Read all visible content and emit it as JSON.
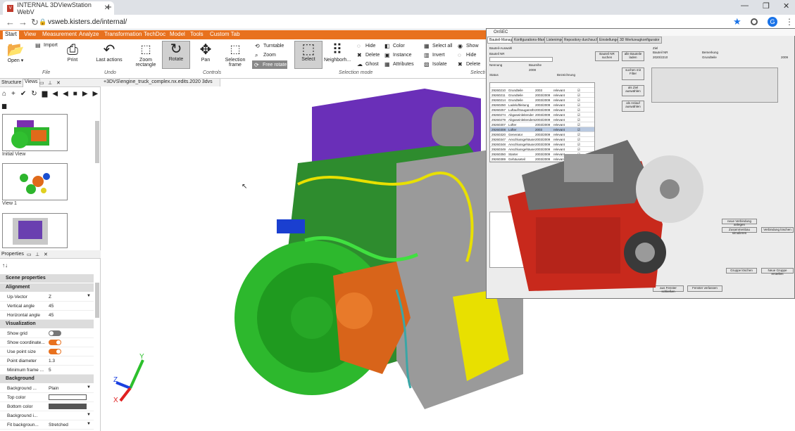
{
  "browser": {
    "tab_title": "INTERNAL 3DViewStation WebV",
    "url": "vsweb.kisters.de/internal/",
    "profile_initial": "G"
  },
  "menu": [
    "Start",
    "View",
    "Measurement",
    "Analyze",
    "Transformation",
    "TechDoc",
    "Model",
    "Tools",
    "Custom Tab"
  ],
  "ribbon": {
    "file": {
      "open": "Open",
      "import": "Import",
      "print": "Print",
      "group": "File"
    },
    "undo": {
      "last_actions": "Last actions",
      "group": "Undo"
    },
    "controls": {
      "zoom_rect": "Zoom rectangle",
      "rotate": "Rotate",
      "pan": "Pan",
      "selection_frame": "Selection frame",
      "turntable": "Turntable",
      "zoom": "Zoom",
      "free_rotate": "Free rotate",
      "group": "Controls"
    },
    "selection": {
      "select": "Select",
      "neighborhood": "Neighborh...",
      "hide": "Hide",
      "delete": "Delete",
      "ghost": "Ghost",
      "color": "Color",
      "instance": "Instance",
      "attributes": "Attributes",
      "group": "Selection mode"
    },
    "select_all": {
      "select_all": "Select all",
      "invert": "Invert",
      "isolate": "Isolate",
      "show": "Show",
      "hide": "Hide",
      "delete": "Delete",
      "group": "Selecti"
    }
  },
  "left": {
    "tabs": [
      "Structure",
      "Views"
    ],
    "views": [
      "Initial View",
      "View 1"
    ],
    "properties_title": "Properties",
    "scene_properties": "Scene properties",
    "sections": {
      "alignment": "Alignment",
      "visualization": "Visualization",
      "background": "Background"
    },
    "alignment_rows": [
      {
        "k": "Up-Vector",
        "v": "Z"
      },
      {
        "k": "Vertical angle",
        "v": "45"
      },
      {
        "k": "Horizontal angle",
        "v": "45"
      }
    ],
    "visualization_rows": [
      {
        "k": "Show grid",
        "on": false
      },
      {
        "k": "Show coordinate...",
        "on": true
      },
      {
        "k": "Use point size",
        "on": true
      }
    ],
    "point_rows": [
      {
        "k": "Point diameter",
        "v": "1.3"
      },
      {
        "k": "Minimum frame ...",
        "v": "5"
      }
    ],
    "background_rows": [
      {
        "k": "Background ...",
        "v": "Plain"
      },
      {
        "k": "Top color",
        "v": ""
      },
      {
        "k": "Bottom color",
        "v": ""
      },
      {
        "k": "Background i...",
        "v": ""
      },
      {
        "k": "Fit backgroun...",
        "v": "Stretched"
      }
    ],
    "colors": {
      "top": "#ffffff",
      "bottom": "#555555"
    }
  },
  "viewport": {
    "tab": "+3DVS\\engine_truck_complex.nx.edits.2020 3dvs",
    "axes": {
      "x": "X",
      "y": "Y",
      "z": "Z"
    }
  },
  "dialog": {
    "title": "OnSEC",
    "tabs": [
      "Bauteil-Manager",
      "Konfigurations-Manager",
      "Listenimport",
      "Repository durchsuchen",
      "Einstellungen",
      "3D Werkzeugkonfigurator"
    ],
    "labels": {
      "bauteil_auswahl": "Bauteil-Auswahl",
      "bauteil_nr": "Bauteil NR",
      "nennung": "Nennung",
      "baureihe": "Baureihe",
      "jahr": "2008",
      "status": "Status",
      "bezeichnung": "Bezeichnung",
      "ziel": "Ziel",
      "bauteil_nr2": "Bauteil NR",
      "bemerkung": "Bemerkung",
      "ziel_val": "2020/2210",
      "ziel_b": "Grundteile",
      "jahr2": "2009"
    },
    "buttons": {
      "bauteil_suchen": "Bauteil NR suchen",
      "alle_laden": "alle Bauteile laden",
      "suchen_filter": "suchen mit Filter",
      "zu_ziel": "als Ziel auswählen",
      "als_anlauf": "als Anlauf auswählen",
      "zusammen": "Zusammenbau simulieren",
      "neue_gruppe": "Neue Gruppe erstellen",
      "gruppe_loschen": "Gruppe löschen",
      "fenster_schliessen": "aus Fenster schließen",
      "fenster_verlassen": "Fenster verlassen",
      "verbindung_loschen": "Verbindung löschen",
      "neue_verbindung": "neue Verbindung anlegen"
    },
    "table": [
      [
        "29260210",
        "Grundteile",
        "2003",
        "relevant"
      ],
      [
        "29260211",
        "Grundteile",
        "2003/2009",
        "relevant"
      ],
      [
        "29260214",
        "Grundteile",
        "2003/2009",
        "relevant"
      ],
      [
        "29260250",
        "Ladeluftleitung",
        "2003/2009",
        "relevant"
      ],
      [
        "29260257",
        "Luftauf/Saugansthr",
        "2003/2009",
        "relevant"
      ],
      [
        "29260274",
        "Abgaseinleitender",
        "2003/2009",
        "relevant"
      ],
      [
        "29260279",
        "Abgaseinleitendem",
        "2003/2009",
        "relevant"
      ],
      [
        "29260307",
        "Lüfter",
        "2003/2009",
        "relevant"
      ],
      [
        "29260308",
        "Lüfter",
        "2003",
        "relevant"
      ],
      [
        "29260320",
        "Generator",
        "2003/2009",
        "relevant"
      ],
      [
        "29260347",
        "Anschlussgehäuse",
        "2003/2009",
        "relevant"
      ],
      [
        "29260348",
        "Anschlussgehäuse",
        "2003/2009",
        "relevant"
      ],
      [
        "29260349",
        "Anschlussgehäuse",
        "2003/2009",
        "relevant"
      ],
      [
        "29260350",
        "Starter",
        "2003/2009",
        "relevant"
      ],
      [
        "29260389",
        "Gehäuseteil",
        "2003/2009",
        "relevant"
      ]
    ]
  }
}
